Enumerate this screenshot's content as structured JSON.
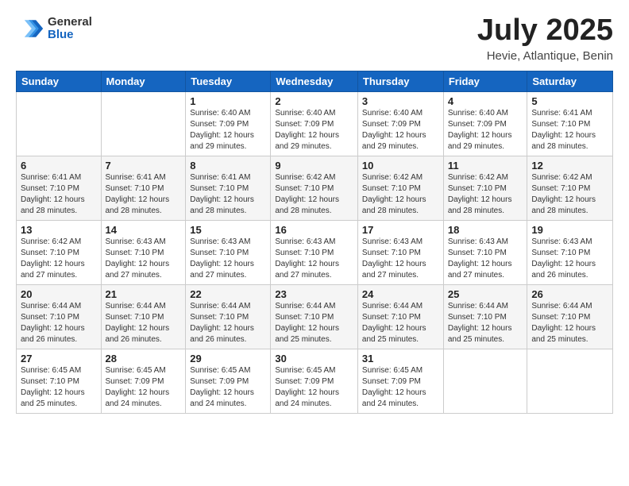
{
  "header": {
    "logo_general": "General",
    "logo_blue": "Blue",
    "title": "July 2025",
    "subtitle": "Hevie, Atlantique, Benin"
  },
  "weekdays": [
    "Sunday",
    "Monday",
    "Tuesday",
    "Wednesday",
    "Thursday",
    "Friday",
    "Saturday"
  ],
  "weeks": [
    [
      {
        "day": "",
        "info": ""
      },
      {
        "day": "",
        "info": ""
      },
      {
        "day": "1",
        "info": "Sunrise: 6:40 AM\nSunset: 7:09 PM\nDaylight: 12 hours and 29 minutes."
      },
      {
        "day": "2",
        "info": "Sunrise: 6:40 AM\nSunset: 7:09 PM\nDaylight: 12 hours and 29 minutes."
      },
      {
        "day": "3",
        "info": "Sunrise: 6:40 AM\nSunset: 7:09 PM\nDaylight: 12 hours and 29 minutes."
      },
      {
        "day": "4",
        "info": "Sunrise: 6:40 AM\nSunset: 7:09 PM\nDaylight: 12 hours and 29 minutes."
      },
      {
        "day": "5",
        "info": "Sunrise: 6:41 AM\nSunset: 7:10 PM\nDaylight: 12 hours and 28 minutes."
      }
    ],
    [
      {
        "day": "6",
        "info": "Sunrise: 6:41 AM\nSunset: 7:10 PM\nDaylight: 12 hours and 28 minutes."
      },
      {
        "day": "7",
        "info": "Sunrise: 6:41 AM\nSunset: 7:10 PM\nDaylight: 12 hours and 28 minutes."
      },
      {
        "day": "8",
        "info": "Sunrise: 6:41 AM\nSunset: 7:10 PM\nDaylight: 12 hours and 28 minutes."
      },
      {
        "day": "9",
        "info": "Sunrise: 6:42 AM\nSunset: 7:10 PM\nDaylight: 12 hours and 28 minutes."
      },
      {
        "day": "10",
        "info": "Sunrise: 6:42 AM\nSunset: 7:10 PM\nDaylight: 12 hours and 28 minutes."
      },
      {
        "day": "11",
        "info": "Sunrise: 6:42 AM\nSunset: 7:10 PM\nDaylight: 12 hours and 28 minutes."
      },
      {
        "day": "12",
        "info": "Sunrise: 6:42 AM\nSunset: 7:10 PM\nDaylight: 12 hours and 28 minutes."
      }
    ],
    [
      {
        "day": "13",
        "info": "Sunrise: 6:42 AM\nSunset: 7:10 PM\nDaylight: 12 hours and 27 minutes."
      },
      {
        "day": "14",
        "info": "Sunrise: 6:43 AM\nSunset: 7:10 PM\nDaylight: 12 hours and 27 minutes."
      },
      {
        "day": "15",
        "info": "Sunrise: 6:43 AM\nSunset: 7:10 PM\nDaylight: 12 hours and 27 minutes."
      },
      {
        "day": "16",
        "info": "Sunrise: 6:43 AM\nSunset: 7:10 PM\nDaylight: 12 hours and 27 minutes."
      },
      {
        "day": "17",
        "info": "Sunrise: 6:43 AM\nSunset: 7:10 PM\nDaylight: 12 hours and 27 minutes."
      },
      {
        "day": "18",
        "info": "Sunrise: 6:43 AM\nSunset: 7:10 PM\nDaylight: 12 hours and 27 minutes."
      },
      {
        "day": "19",
        "info": "Sunrise: 6:43 AM\nSunset: 7:10 PM\nDaylight: 12 hours and 26 minutes."
      }
    ],
    [
      {
        "day": "20",
        "info": "Sunrise: 6:44 AM\nSunset: 7:10 PM\nDaylight: 12 hours and 26 minutes."
      },
      {
        "day": "21",
        "info": "Sunrise: 6:44 AM\nSunset: 7:10 PM\nDaylight: 12 hours and 26 minutes."
      },
      {
        "day": "22",
        "info": "Sunrise: 6:44 AM\nSunset: 7:10 PM\nDaylight: 12 hours and 26 minutes."
      },
      {
        "day": "23",
        "info": "Sunrise: 6:44 AM\nSunset: 7:10 PM\nDaylight: 12 hours and 25 minutes."
      },
      {
        "day": "24",
        "info": "Sunrise: 6:44 AM\nSunset: 7:10 PM\nDaylight: 12 hours and 25 minutes."
      },
      {
        "day": "25",
        "info": "Sunrise: 6:44 AM\nSunset: 7:10 PM\nDaylight: 12 hours and 25 minutes."
      },
      {
        "day": "26",
        "info": "Sunrise: 6:44 AM\nSunset: 7:10 PM\nDaylight: 12 hours and 25 minutes."
      }
    ],
    [
      {
        "day": "27",
        "info": "Sunrise: 6:45 AM\nSunset: 7:10 PM\nDaylight: 12 hours and 25 minutes."
      },
      {
        "day": "28",
        "info": "Sunrise: 6:45 AM\nSunset: 7:09 PM\nDaylight: 12 hours and 24 minutes."
      },
      {
        "day": "29",
        "info": "Sunrise: 6:45 AM\nSunset: 7:09 PM\nDaylight: 12 hours and 24 minutes."
      },
      {
        "day": "30",
        "info": "Sunrise: 6:45 AM\nSunset: 7:09 PM\nDaylight: 12 hours and 24 minutes."
      },
      {
        "day": "31",
        "info": "Sunrise: 6:45 AM\nSunset: 7:09 PM\nDaylight: 12 hours and 24 minutes."
      },
      {
        "day": "",
        "info": ""
      },
      {
        "day": "",
        "info": ""
      }
    ]
  ]
}
